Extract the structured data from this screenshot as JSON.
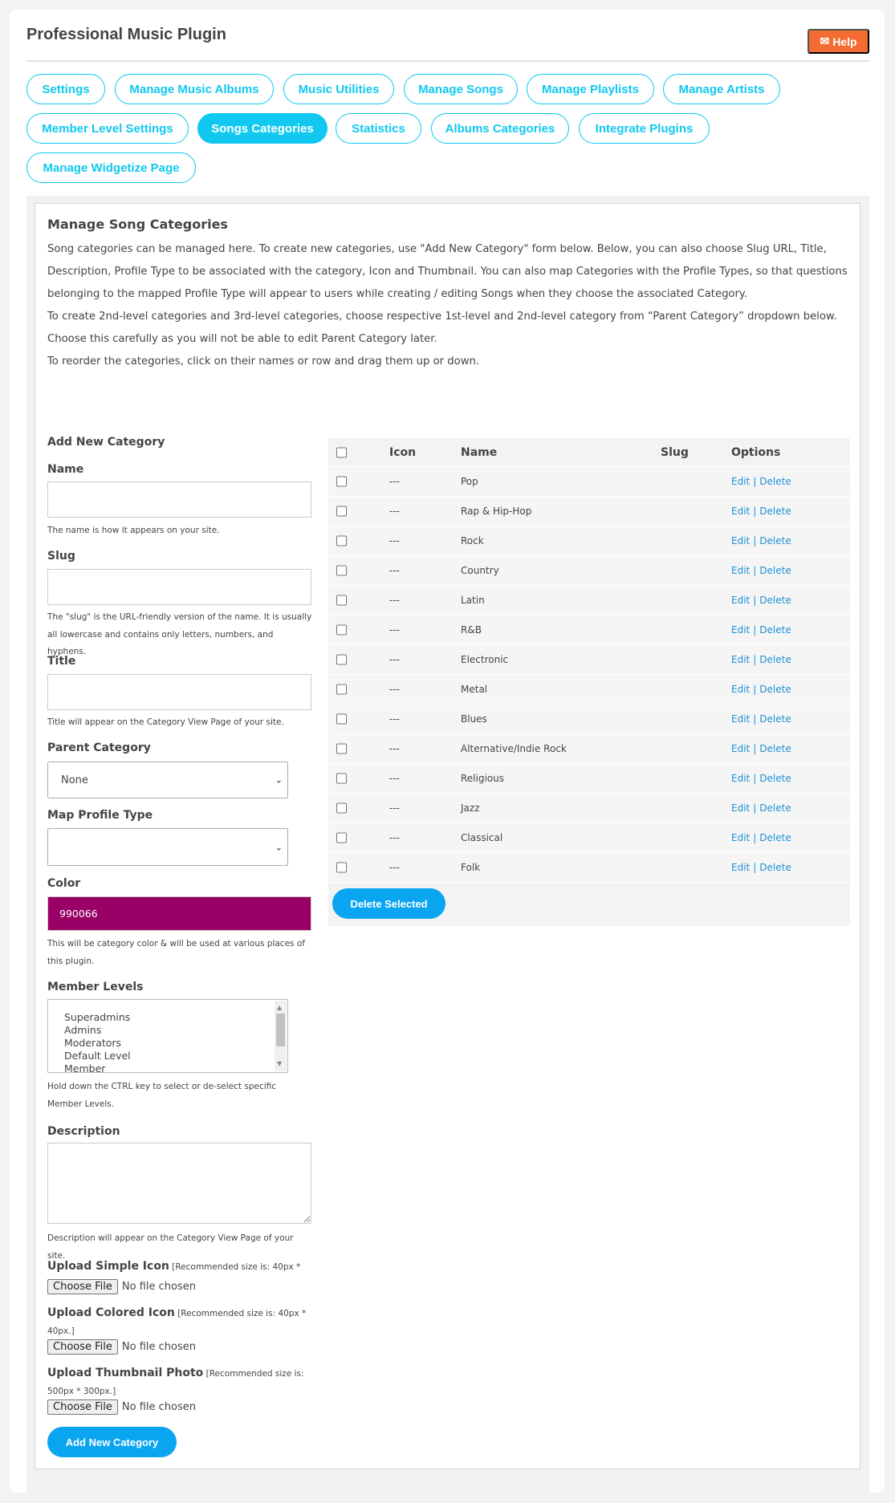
{
  "header": {
    "title": "Professional Music Plugin",
    "help_label": "Help",
    "help_icon": "envelope-icon"
  },
  "tabs": [
    {
      "label": "Settings",
      "active": false
    },
    {
      "label": "Manage Music Albums",
      "active": false
    },
    {
      "label": "Music Utilities",
      "active": false
    },
    {
      "label": "Manage Songs",
      "active": false
    },
    {
      "label": "Manage Playlists",
      "active": false
    },
    {
      "label": "Manage Artists",
      "active": false
    },
    {
      "label": "Member Level Settings",
      "active": false
    },
    {
      "label": "Songs Categories",
      "active": true
    },
    {
      "label": "Statistics",
      "active": false
    },
    {
      "label": "Albums Categories",
      "active": false
    },
    {
      "label": "Integrate Plugins",
      "active": false
    },
    {
      "label": "Manage Widgetize Page",
      "active": false
    }
  ],
  "main": {
    "heading": "Manage Song Categories",
    "intro_1": "Song categories can be managed here. To create new categories, use \"Add New Category\" form below. Below, you can also choose Slug URL, Title, Description, Profile Type to be associated with the category, Icon and Thumbnail. You can also map Categories with the Profile Types, so that questions belonging to the mapped Profile Type will appear to users while creating / editing Songs when they choose the associated Category.",
    "intro_2": "To create 2nd-level categories and 3rd-level categories, choose respective 1st-level and 2nd-level category from “Parent Category” dropdown below. Choose this carefully as you will not be able to edit Parent Category later.",
    "intro_3": "To reorder the categories, click on their names or row and drag them up or down."
  },
  "form": {
    "heading": "Add New Category",
    "name_label": "Name",
    "name_value": "",
    "name_hint": "The name is how it appears on your site.",
    "slug_label": "Slug",
    "slug_value": "",
    "slug_hint": "The \"slug\" is the URL-friendly version of the name. It is usually all lowercase and contains only letters, numbers, and hyphens.",
    "title_label": "Title",
    "title_value": "",
    "title_hint": "Title will appear on the Category View Page of your site.",
    "parent_label": "Parent Category",
    "parent_value": "None",
    "profile_label": "Map Profile Type",
    "profile_value": "",
    "color_label": "Color",
    "color_value": "990066",
    "color_hex": "#990066",
    "color_hint": "This will be category color & will be used at various places of this plugin.",
    "levels_label": "Member Levels",
    "levels": [
      "Superadmins",
      "Admins",
      "Moderators",
      "Default Level",
      "Member"
    ],
    "levels_hint": "Hold down the CTRL key to select or de-select specific Member Levels.",
    "desc_label": "Description",
    "desc_value": "",
    "desc_hint": "Description will appear on the Category View Page of your site.",
    "simple_icon_label": "Upload Simple Icon",
    "simple_icon_note": "[Recommended size is: 40px * 40px.]",
    "colored_icon_label": "Upload Colored Icon",
    "colored_icon_note": "[Recommended size is: 40px * 40px.]",
    "thumb_label": "Upload Thumbnail Photo",
    "thumb_note": "[Recommended size is: 500px * 300px.]",
    "choose_file": "Choose File",
    "no_file": "No file chosen",
    "submit_label": "Add New Category"
  },
  "table": {
    "headers": {
      "icon": "Icon",
      "name": "Name",
      "slug": "Slug",
      "options": "Options"
    },
    "edit_label": "Edit",
    "delete_label": "Delete",
    "separator": "|",
    "rows": [
      {
        "icon": "---",
        "name": "Pop",
        "slug": ""
      },
      {
        "icon": "---",
        "name": "Rap & Hip-Hop",
        "slug": ""
      },
      {
        "icon": "---",
        "name": "Rock",
        "slug": ""
      },
      {
        "icon": "---",
        "name": "Country",
        "slug": ""
      },
      {
        "icon": "---",
        "name": "Latin",
        "slug": ""
      },
      {
        "icon": "---",
        "name": "R&B",
        "slug": ""
      },
      {
        "icon": "---",
        "name": "Electronic",
        "slug": ""
      },
      {
        "icon": "---",
        "name": "Metal",
        "slug": ""
      },
      {
        "icon": "---",
        "name": "Blues",
        "slug": ""
      },
      {
        "icon": "---",
        "name": "Alternative/Indie Rock",
        "slug": ""
      },
      {
        "icon": "---",
        "name": "Religious",
        "slug": ""
      },
      {
        "icon": "---",
        "name": "Jazz",
        "slug": ""
      },
      {
        "icon": "---",
        "name": "Classical",
        "slug": ""
      },
      {
        "icon": "---",
        "name": "Folk",
        "slug": ""
      }
    ],
    "delete_selected_label": "Delete Selected"
  },
  "colors": {
    "accent": "#10c8f0",
    "help": "#f36c32",
    "button": "#0aa5f0",
    "link": "#1e90d6"
  }
}
